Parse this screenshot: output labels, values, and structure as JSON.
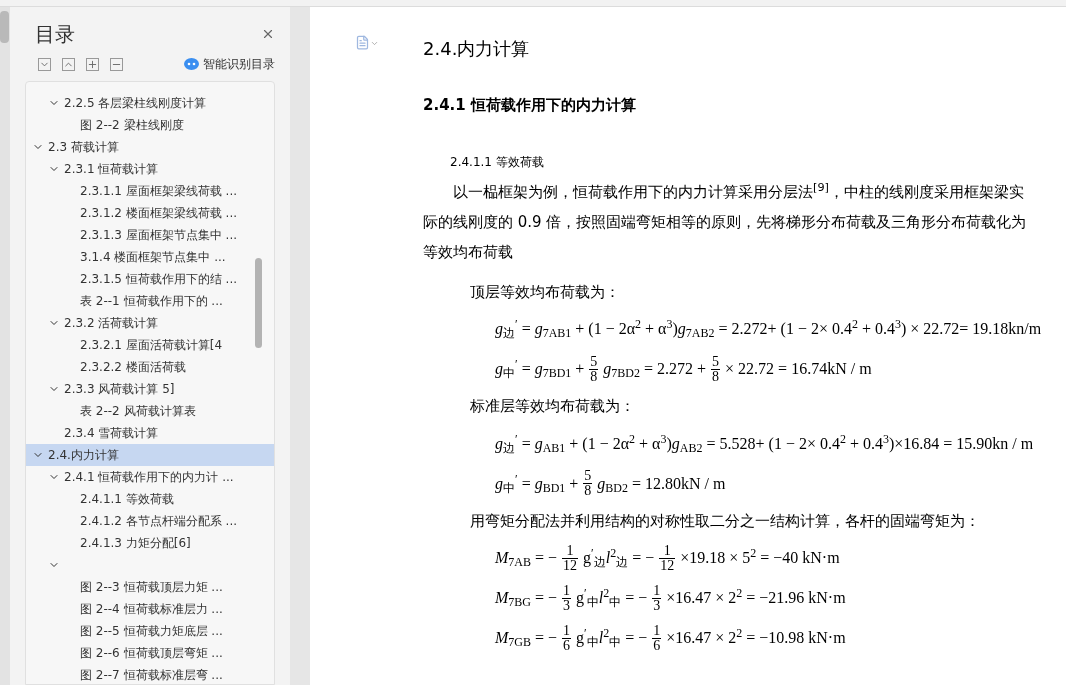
{
  "toc": {
    "title": "目录",
    "smart_button": "智能识别目录",
    "scrolled_parent_children": [
      {
        "label": "2.2.5 各层梁柱线刚度计算",
        "expanded": true,
        "selected": false,
        "children": [
          {
            "label": "图  2--2 梁柱线刚度",
            "selected": false
          }
        ]
      }
    ],
    "items": [
      {
        "label": "2.3 荷载计算",
        "expanded": true,
        "selected": false,
        "children": [
          {
            "label": "2.3.1 恒荷载计算",
            "expanded": true,
            "selected": false,
            "children": [
              {
                "label": "2.3.1.1 屋面框架梁线荷载 ...",
                "selected": false
              },
              {
                "label": "2.3.1.2 楼面框架梁线荷载 ...",
                "selected": false
              },
              {
                "label": "2.3.1.3 屋面框架节点集中 ...",
                "selected": false
              },
              {
                "label": "3.1.4  楼面框架节点集中 ...",
                "selected": false
              },
              {
                "label": "2.3.1.5 恒荷载作用下的结 ...",
                "selected": false
              },
              {
                "label": "表  2--1 恒荷载作用下的 ...",
                "selected": false
              }
            ]
          },
          {
            "label": "2.3.2 活荷载计算",
            "expanded": true,
            "selected": false,
            "children": [
              {
                "label": "2.3.2.1 屋面活荷载计算[4",
                "selected": false
              },
              {
                "label": "2.3.2.2  楼面活荷载",
                "selected": false
              }
            ]
          },
          {
            "label": "2.3.3 风荷载计算 5]",
            "expanded": true,
            "selected": false,
            "children": [
              {
                "label": "表  2--2 风荷载计算表",
                "selected": false
              }
            ]
          },
          {
            "label": "2.3.4 雪荷载计算",
            "selected": false
          }
        ]
      },
      {
        "label": "2.4.内力计算",
        "expanded": true,
        "selected": true,
        "children": [
          {
            "label": "2.4.1 恒荷载作用下的内力计 ...",
            "expanded": true,
            "selected": false,
            "children": [
              {
                "label": "2.4.1.1 等效荷载",
                "selected": false
              },
              {
                "label": "2.4.1.2 各节点杆端分配系 ...",
                "selected": false
              },
              {
                "label": "2.4.1.3 力矩分配[6]",
                "selected": false
              }
            ]
          },
          {
            "expanded": true,
            "selected": false,
            "children": [
              {
                "label": "图  2--3  恒荷载顶层力矩 ...",
                "selected": false
              },
              {
                "label": "图  2--4 恒荷载标准层力 ...",
                "selected": false
              },
              {
                "label": "图  2--5 恒荷载力矩底层 ...",
                "selected": false
              },
              {
                "label": "图  2--6 恒荷载顶层弯矩 ...",
                "selected": false
              },
              {
                "label": "图  2--7 恒荷载标准层弯 ...",
                "selected": false
              }
            ]
          }
        ]
      }
    ]
  },
  "document": {
    "blocks": [
      {
        "kind": "heading1",
        "text": "2.4.内力计算"
      },
      {
        "kind": "heading2",
        "text": "2.4.1 恒荷载作用下的内力计算"
      },
      {
        "kind": "heading3",
        "text": "2.4.1.1 等效荷载"
      },
      {
        "kind": "paragraph",
        "text": "以一榀框架为例，恒荷载作用下的内力计算采用分层法$^{[9]}$，中柱的线刚度采用框架梁实际的线刚度的 0.9 倍，按照固端弯矩相等的原则，先将梯形分布荷载及三角形分布荷载化为等效均布荷载"
      },
      {
        "kind": "label",
        "text": "顶层等效均布荷载为："
      },
      {
        "kind": "formula",
        "parts": [
          {
            "kind": "text",
            "s": "*g*$_{边}$$^{′}$ = *g*$_{7AB1}$ + (1 − 2α$^{2}$ + α$^{3}$)*g*$_{7AB2}$ = 2.272+ (1 − 2× 0.4$^{2}$ + 0.4$^{3}$) × 22.72= 19.18kn/m"
          }
        ]
      },
      {
        "kind": "formula",
        "parts": [
          {
            "kind": "text",
            "s": "*g*$_{中}$$^{′}$ = *g*$_{7BD1}$ +"
          },
          {
            "kind": "frac",
            "num": "5",
            "den": "8"
          },
          {
            "kind": "text",
            "s": "*g*$_{7BD2}$ = 2.272 +"
          },
          {
            "kind": "frac",
            "num": "5",
            "den": "8"
          },
          {
            "kind": "text",
            "s": "× 22.72  = 16.74kN / m"
          }
        ]
      },
      {
        "kind": "label",
        "text": "标准层等效均布荷载为："
      },
      {
        "kind": "formula",
        "parts": [
          {
            "kind": "text",
            "s": "*g*$_{边}$$^{′}$ = *g*$_{AB1}$ + (1 − 2α$^{2}$ + α$^{3}$)*g*$_{AB2}$ = 5.528+ (1 − 2× 0.4$^{2}$ + 0.4$^{3}$)×16.84 = 15.90kn / m"
          }
        ]
      },
      {
        "kind": "formula",
        "parts": [
          {
            "kind": "text",
            "s": "*g*$_{中}$$^{′}$ = *g*$_{BD1}$ +"
          },
          {
            "kind": "frac",
            "num": "5",
            "den": "8"
          },
          {
            "kind": "text",
            "s": "*g*$_{BD2}$ = 12.80kN  / m"
          }
        ]
      },
      {
        "kind": "label",
        "text": "用弯矩分配法并利用结构的对称性取二分之一结构计算，各杆的固端弯矩为："
      },
      {
        "kind": "formula",
        "parts": [
          {
            "kind": "text",
            "s": "*M*$_{7AB}$ = −"
          },
          {
            "kind": "frac",
            "num": "1",
            "den": "12"
          },
          {
            "kind": "text",
            "s": "g$^{′}$$_{边}$*l*$^{2}$$_{边}$ = −"
          },
          {
            "kind": "frac",
            "num": "1",
            "den": "12"
          },
          {
            "kind": "text",
            "s": "×19.18 × 5$^{2}$ = −40 kN·m"
          }
        ]
      },
      {
        "kind": "formula",
        "parts": [
          {
            "kind": "text",
            "s": "*M*$_{7BG}$ = −"
          },
          {
            "kind": "frac",
            "num": "1",
            "den": "3"
          },
          {
            "kind": "text",
            "s": "g$^{′}$$_{中}$*l*$^{2}$$_{中}$ = −"
          },
          {
            "kind": "frac",
            "num": "1",
            "den": "3"
          },
          {
            "kind": "text",
            "s": "×16.47 × 2$^{2}$ = −21.96 kN·m"
          }
        ]
      },
      {
        "kind": "formula",
        "parts": [
          {
            "kind": "text",
            "s": "*M*$_{7GB}$ = −"
          },
          {
            "kind": "frac",
            "num": "1",
            "den": "6"
          },
          {
            "kind": "text",
            "s": "g$^{′}$$_{中}$*l*$^{2}$$_{中}$ = −"
          },
          {
            "kind": "frac",
            "num": "1",
            "den": "6"
          },
          {
            "kind": "text",
            "s": "×16.47 × 2$^{2}$ = −10.98 kN·m"
          }
        ]
      }
    ]
  }
}
